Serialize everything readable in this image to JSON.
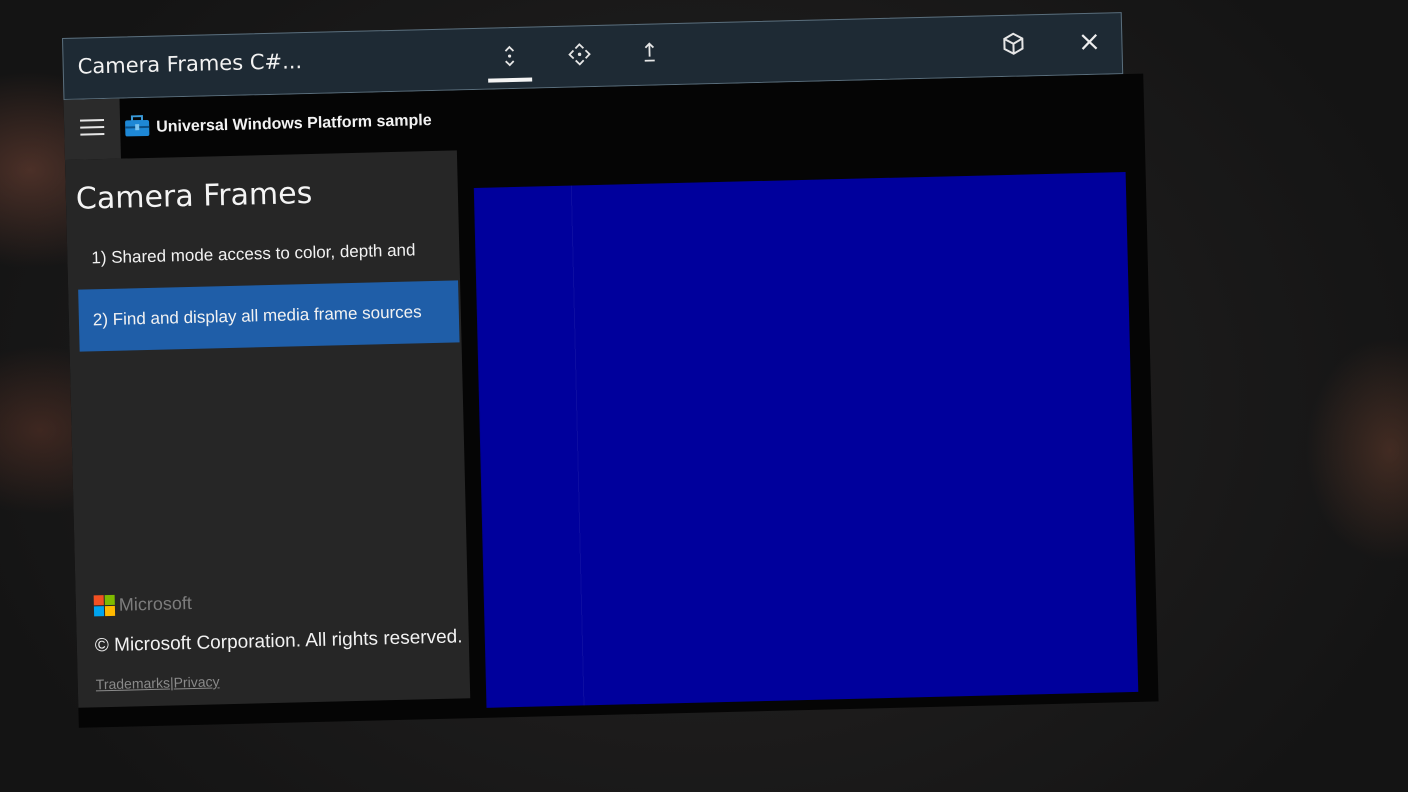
{
  "window": {
    "title": "Camera Frames C#...",
    "buttons": {
      "adjust": "adjust-icon",
      "move": "move-icon",
      "follow": "follow-icon",
      "hologram": "hologram-view-icon",
      "close": "close-icon"
    }
  },
  "header": {
    "sample_title": "Universal Windows Platform sample",
    "menu_icon": "hamburger-menu-icon",
    "sample_icon": "toolbox-icon"
  },
  "sidebar": {
    "title": "Camera Frames",
    "scenarios": [
      {
        "label": "1) Shared mode access to color, depth and",
        "selected": false
      },
      {
        "label": "2) Find and display all media frame sources",
        "selected": true
      }
    ],
    "brand": "Microsoft",
    "copyright": "© Microsoft Corporation. All rights reserved.",
    "links": {
      "trademarks": "Trademarks",
      "separator": "|",
      "privacy": "Privacy"
    }
  },
  "colors": {
    "selected_item": "#1f5ea8",
    "preview_fill": "#00009c",
    "titlebar": "#1e2a34"
  }
}
